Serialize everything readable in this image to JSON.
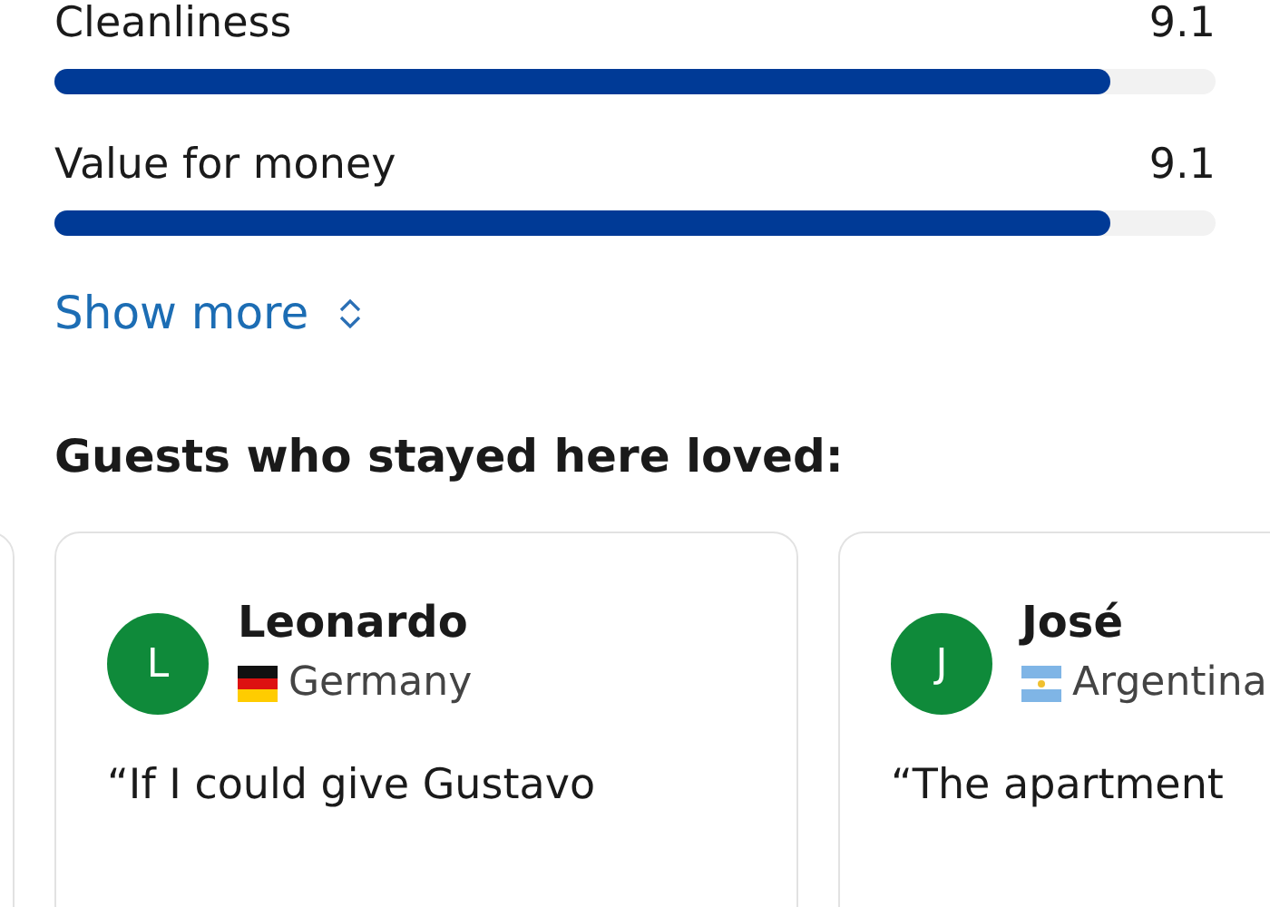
{
  "ratings": [
    {
      "label": "Cleanliness",
      "score": "9.1",
      "level": 0.91
    },
    {
      "label": "Value for money",
      "score": "9.1",
      "level": 0.91
    }
  ],
  "show_more": "Show more",
  "section_title": "Guests who stayed here loved:",
  "reviews": [
    {
      "initial": "L",
      "name": "Leonardo",
      "kind": "de",
      "country": "Germany",
      "quote": "“If I could give Gustavo"
    },
    {
      "initial": "J",
      "name": "José",
      "kind": "ar",
      "country": "Argentina",
      "quote": "“The apartment"
    }
  ]
}
